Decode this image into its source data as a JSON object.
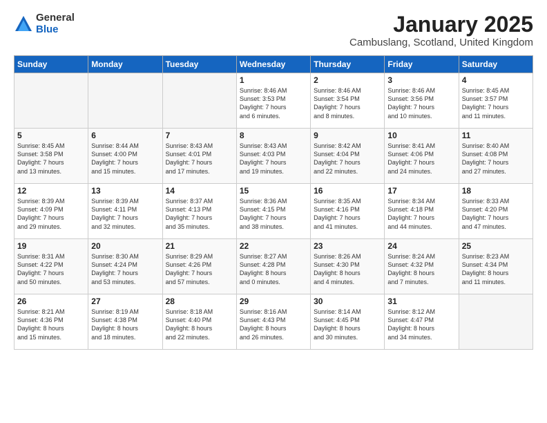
{
  "logo": {
    "general": "General",
    "blue": "Blue"
  },
  "title": "January 2025",
  "subtitle": "Cambuslang, Scotland, United Kingdom",
  "headers": [
    "Sunday",
    "Monday",
    "Tuesday",
    "Wednesday",
    "Thursday",
    "Friday",
    "Saturday"
  ],
  "weeks": [
    [
      {
        "day": "",
        "info": ""
      },
      {
        "day": "",
        "info": ""
      },
      {
        "day": "",
        "info": ""
      },
      {
        "day": "1",
        "info": "Sunrise: 8:46 AM\nSunset: 3:53 PM\nDaylight: 7 hours\nand 6 minutes."
      },
      {
        "day": "2",
        "info": "Sunrise: 8:46 AM\nSunset: 3:54 PM\nDaylight: 7 hours\nand 8 minutes."
      },
      {
        "day": "3",
        "info": "Sunrise: 8:46 AM\nSunset: 3:56 PM\nDaylight: 7 hours\nand 10 minutes."
      },
      {
        "day": "4",
        "info": "Sunrise: 8:45 AM\nSunset: 3:57 PM\nDaylight: 7 hours\nand 11 minutes."
      }
    ],
    [
      {
        "day": "5",
        "info": "Sunrise: 8:45 AM\nSunset: 3:58 PM\nDaylight: 7 hours\nand 13 minutes."
      },
      {
        "day": "6",
        "info": "Sunrise: 8:44 AM\nSunset: 4:00 PM\nDaylight: 7 hours\nand 15 minutes."
      },
      {
        "day": "7",
        "info": "Sunrise: 8:43 AM\nSunset: 4:01 PM\nDaylight: 7 hours\nand 17 minutes."
      },
      {
        "day": "8",
        "info": "Sunrise: 8:43 AM\nSunset: 4:03 PM\nDaylight: 7 hours\nand 19 minutes."
      },
      {
        "day": "9",
        "info": "Sunrise: 8:42 AM\nSunset: 4:04 PM\nDaylight: 7 hours\nand 22 minutes."
      },
      {
        "day": "10",
        "info": "Sunrise: 8:41 AM\nSunset: 4:06 PM\nDaylight: 7 hours\nand 24 minutes."
      },
      {
        "day": "11",
        "info": "Sunrise: 8:40 AM\nSunset: 4:08 PM\nDaylight: 7 hours\nand 27 minutes."
      }
    ],
    [
      {
        "day": "12",
        "info": "Sunrise: 8:39 AM\nSunset: 4:09 PM\nDaylight: 7 hours\nand 29 minutes."
      },
      {
        "day": "13",
        "info": "Sunrise: 8:39 AM\nSunset: 4:11 PM\nDaylight: 7 hours\nand 32 minutes."
      },
      {
        "day": "14",
        "info": "Sunrise: 8:37 AM\nSunset: 4:13 PM\nDaylight: 7 hours\nand 35 minutes."
      },
      {
        "day": "15",
        "info": "Sunrise: 8:36 AM\nSunset: 4:15 PM\nDaylight: 7 hours\nand 38 minutes."
      },
      {
        "day": "16",
        "info": "Sunrise: 8:35 AM\nSunset: 4:16 PM\nDaylight: 7 hours\nand 41 minutes."
      },
      {
        "day": "17",
        "info": "Sunrise: 8:34 AM\nSunset: 4:18 PM\nDaylight: 7 hours\nand 44 minutes."
      },
      {
        "day": "18",
        "info": "Sunrise: 8:33 AM\nSunset: 4:20 PM\nDaylight: 7 hours\nand 47 minutes."
      }
    ],
    [
      {
        "day": "19",
        "info": "Sunrise: 8:31 AM\nSunset: 4:22 PM\nDaylight: 7 hours\nand 50 minutes."
      },
      {
        "day": "20",
        "info": "Sunrise: 8:30 AM\nSunset: 4:24 PM\nDaylight: 7 hours\nand 53 minutes."
      },
      {
        "day": "21",
        "info": "Sunrise: 8:29 AM\nSunset: 4:26 PM\nDaylight: 7 hours\nand 57 minutes."
      },
      {
        "day": "22",
        "info": "Sunrise: 8:27 AM\nSunset: 4:28 PM\nDaylight: 8 hours\nand 0 minutes."
      },
      {
        "day": "23",
        "info": "Sunrise: 8:26 AM\nSunset: 4:30 PM\nDaylight: 8 hours\nand 4 minutes."
      },
      {
        "day": "24",
        "info": "Sunrise: 8:24 AM\nSunset: 4:32 PM\nDaylight: 8 hours\nand 7 minutes."
      },
      {
        "day": "25",
        "info": "Sunrise: 8:23 AM\nSunset: 4:34 PM\nDaylight: 8 hours\nand 11 minutes."
      }
    ],
    [
      {
        "day": "26",
        "info": "Sunrise: 8:21 AM\nSunset: 4:36 PM\nDaylight: 8 hours\nand 15 minutes."
      },
      {
        "day": "27",
        "info": "Sunrise: 8:19 AM\nSunset: 4:38 PM\nDaylight: 8 hours\nand 18 minutes."
      },
      {
        "day": "28",
        "info": "Sunrise: 8:18 AM\nSunset: 4:40 PM\nDaylight: 8 hours\nand 22 minutes."
      },
      {
        "day": "29",
        "info": "Sunrise: 8:16 AM\nSunset: 4:43 PM\nDaylight: 8 hours\nand 26 minutes."
      },
      {
        "day": "30",
        "info": "Sunrise: 8:14 AM\nSunset: 4:45 PM\nDaylight: 8 hours\nand 30 minutes."
      },
      {
        "day": "31",
        "info": "Sunrise: 8:12 AM\nSunset: 4:47 PM\nDaylight: 8 hours\nand 34 minutes."
      },
      {
        "day": "",
        "info": ""
      }
    ]
  ]
}
